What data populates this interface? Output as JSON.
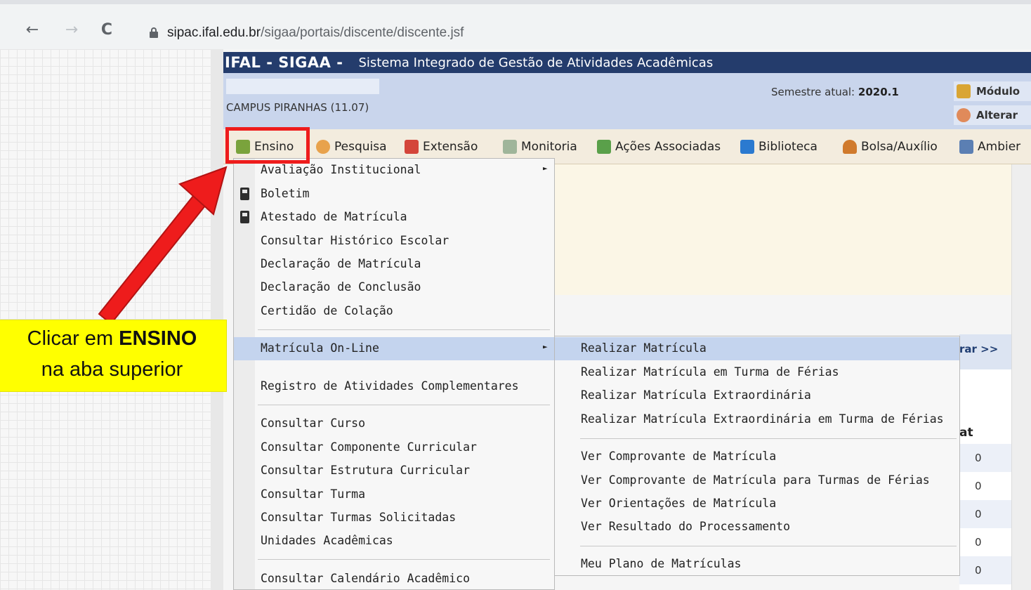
{
  "browser": {
    "back_icon": "←",
    "forward_icon": "→",
    "reload_icon": "C",
    "url_host": "sipac.ifal.edu.br",
    "url_path": "/sigaa/portais/discente/discente.jsf"
  },
  "header": {
    "brand": "IFAL - SIGAA -",
    "subtitle": "Sistema Integrado de Gestão de Atividades Acadêmicas",
    "campus": "CAMPUS PIRANHAS (11.07)",
    "semester_label": "Semestre atual:",
    "semester_value": "2020.1",
    "modulo_link": "Módulo",
    "alterar_link": "Alterar"
  },
  "top_menu": {
    "ensino": "Ensino",
    "pesquisa": "Pesquisa",
    "extensao": "Extensão",
    "monitoria": "Monitoria",
    "acoes": "Ações Associadas",
    "biblioteca": "Biblioteca",
    "bolsa": "Bolsa/Auxílio",
    "ambiente": "Ambier"
  },
  "ensino_menu": {
    "items": [
      "Avaliação Institucional",
      "Boletim",
      "Atestado de Matrícula",
      "Consultar Histórico Escolar",
      "Declaração de Matrícula",
      "Declaração de Conclusão",
      "Certidão de Colação",
      "Matrícula On-Line",
      "Registro de Atividades Complementares",
      "Consultar Curso",
      "Consultar Componente Curricular",
      "Consultar Estrutura Curricular",
      "Consultar Turma",
      "Consultar Turmas Solicitadas",
      "Unidades Acadêmicas",
      "Consultar Calendário Acadêmico"
    ]
  },
  "matricula_submenu": {
    "items": [
      "Realizar Matrícula",
      "Realizar Matrícula em Turma de Férias",
      "Realizar Matrícula Extraordinária",
      "Realizar Matrícula Extraordinária em Turma de Férias",
      "Ver Comprovante de Matrícula",
      "Ver Comprovante de Matrícula para Turmas de Férias",
      "Ver Orientações de Matrícula",
      "Ver Resultado do Processamento",
      "Meu Plano de Matrículas"
    ]
  },
  "right_panel": {
    "link_fragment": "rar >>",
    "col_fragment": "at",
    "values": [
      "0",
      "0",
      "0",
      "0",
      "0"
    ]
  },
  "annotation": {
    "line1_prefix": "Clicar em ",
    "line1_bold": "ENSINO",
    "line2": "na aba superior",
    "color": "#ffff00",
    "arrow_color": "#ee1c1c"
  }
}
